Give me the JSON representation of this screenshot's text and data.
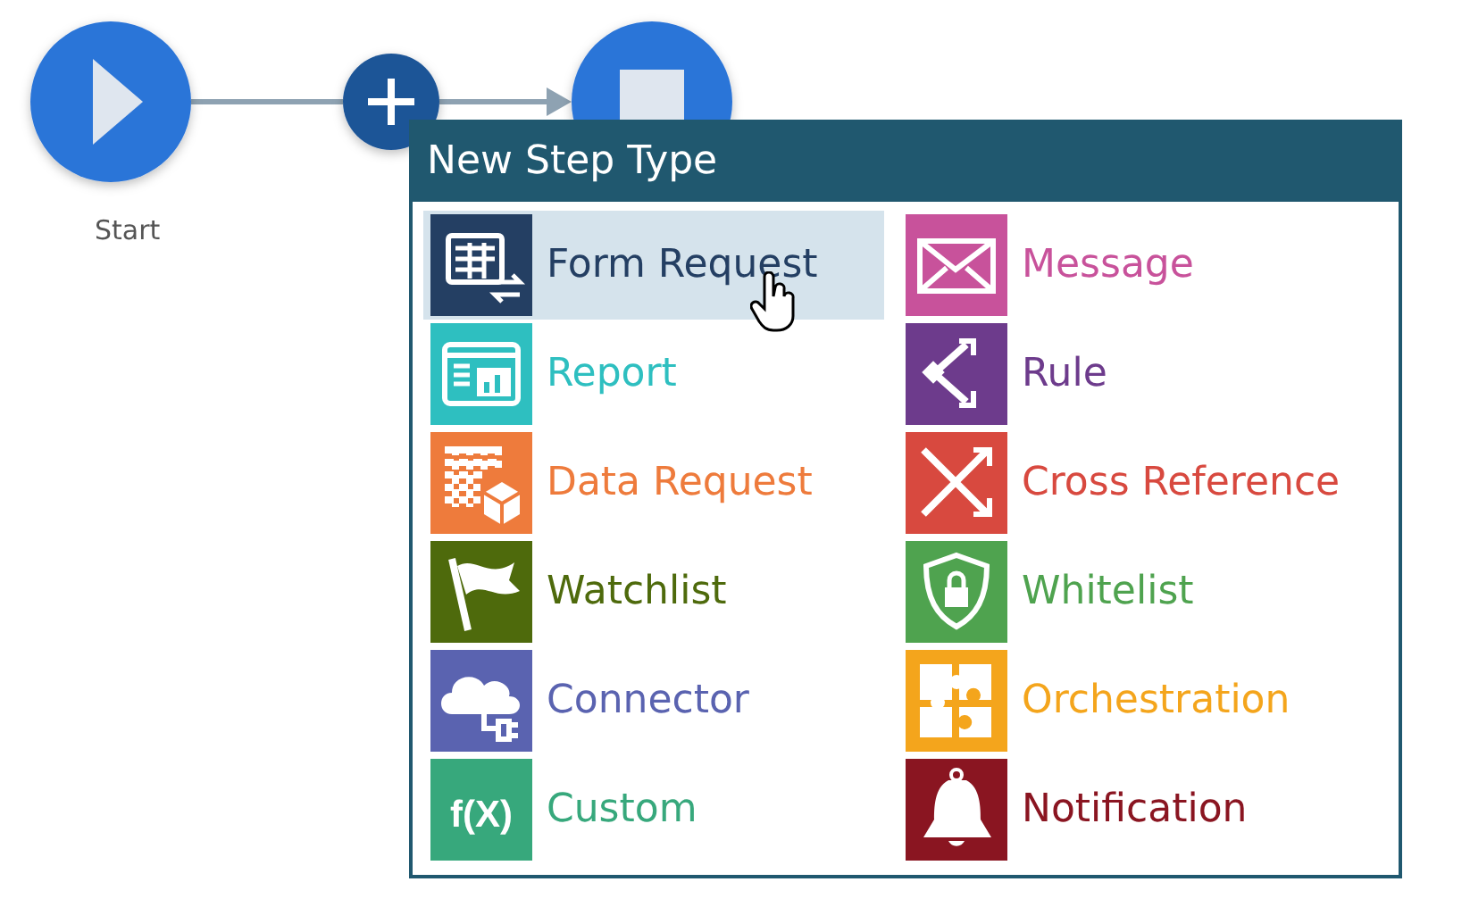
{
  "canvas": {
    "nodes": [
      {
        "kind": "start",
        "label": "Start"
      },
      {
        "kind": "add"
      },
      {
        "kind": "stop"
      }
    ]
  },
  "popup": {
    "title": "New Step Type",
    "items": [
      {
        "label": "Form Request",
        "color": "#243f63",
        "selected": true
      },
      {
        "label": "Report",
        "color": "#2ebfc0",
        "selected": false
      },
      {
        "label": "Data Request",
        "color": "#ee7b3c",
        "selected": false
      },
      {
        "label": "Watchlist",
        "color": "#4e6a0c",
        "selected": false
      },
      {
        "label": "Connector",
        "color": "#5a63b0",
        "selected": false
      },
      {
        "label": "Custom",
        "color": "#37a87c",
        "selected": false,
        "icon_text": "f(X)"
      },
      {
        "label": "Message",
        "color": "#c8529b",
        "selected": false
      },
      {
        "label": "Rule",
        "color": "#6d3b8c",
        "selected": false
      },
      {
        "label": "Cross Reference",
        "color": "#d8493f",
        "selected": false
      },
      {
        "label": "Whitelist",
        "color": "#4fa34f",
        "selected": false
      },
      {
        "label": "Orchestration",
        "color": "#f4a51c",
        "selected": false
      },
      {
        "label": "Notification",
        "color": "#8a1521",
        "selected": false
      }
    ]
  }
}
